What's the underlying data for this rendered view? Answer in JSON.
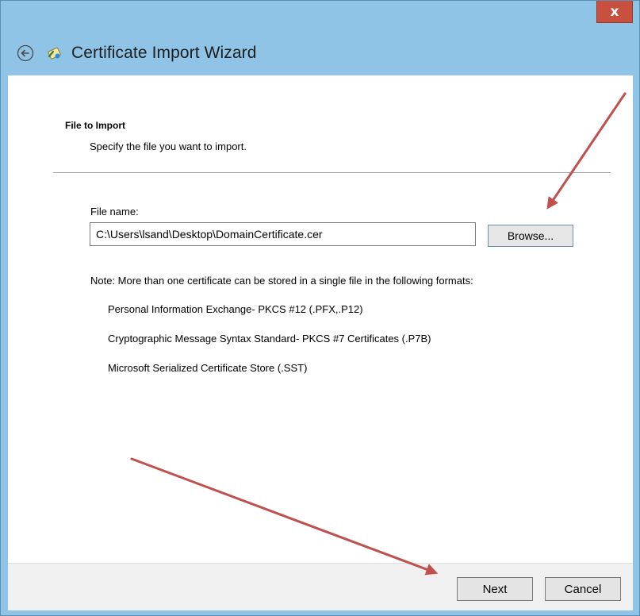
{
  "titlebar": {
    "close_label": "x"
  },
  "header": {
    "title": "Certificate Import Wizard",
    "back_icon": "back-arrow-icon",
    "wizard_icon": "certificate-icon"
  },
  "section": {
    "title": "File to Import",
    "description": "Specify the file you want to import."
  },
  "file": {
    "label": "File name:",
    "value": "C:\\Users\\lsand\\Desktop\\DomainCertificate.cer",
    "browse_label": "Browse..."
  },
  "note": {
    "text": "Note:  More than one certificate can be stored in a single file in the following formats:",
    "formats": [
      "Personal Information Exchange- PKCS #12 (.PFX,.P12)",
      "Cryptographic Message Syntax Standard- PKCS #7 Certificates (.P7B)",
      "Microsoft Serialized Certificate Store (.SST)"
    ]
  },
  "footer": {
    "next_label": "Next",
    "cancel_label": "Cancel"
  },
  "colors": {
    "window_frame": "#8fc4e6",
    "close_button": "#c7503f",
    "annotation_arrow": "#c0504d"
  }
}
